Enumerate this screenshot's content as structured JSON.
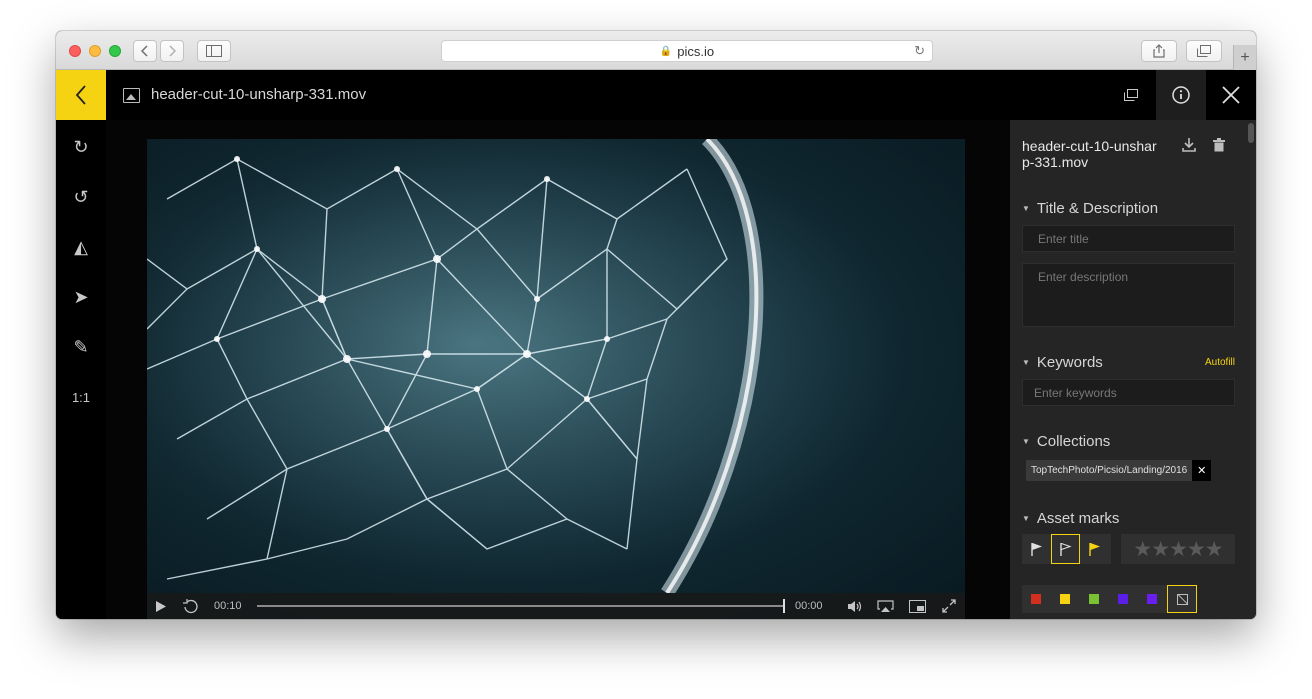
{
  "browser": {
    "url": "pics.io",
    "lock_glyph": "🔒",
    "reload_glyph": "↻",
    "new_tab_glyph": "+"
  },
  "header": {
    "file_name": "header-cut-10-unsharp-331.mov"
  },
  "tools": [
    {
      "name": "rotate-cw-icon",
      "glyph": "↻"
    },
    {
      "name": "rotate-ccw-icon",
      "glyph": "↺"
    },
    {
      "name": "flip-icon",
      "glyph": "◭"
    },
    {
      "name": "send-icon",
      "glyph": "➤"
    },
    {
      "name": "pencil-icon",
      "glyph": "✎"
    },
    {
      "name": "actual-size-icon",
      "glyph": "1:1"
    }
  ],
  "player": {
    "current_time": "00:10",
    "duration": "00:00",
    "progress": 1.0
  },
  "panel": {
    "title": "header-cut-10-unsharp-331.mov",
    "title_description": {
      "heading": "Title & Description",
      "title_placeholder": "Enter title",
      "description_placeholder": "Enter description"
    },
    "keywords": {
      "heading": "Keywords",
      "autofill": "Autofill",
      "placeholder": "Enter keywords"
    },
    "collections": {
      "heading": "Collections",
      "chip": "TopTechPhoto/Picsio/Landing/2016",
      "remove": "✕"
    },
    "asset_marks": {
      "heading": "Asset marks",
      "stars": "★★★★★",
      "rating": 0,
      "selected_flag": "unflagged"
    },
    "color_labels": [
      "#d32f1f",
      "#f5d312",
      "#7bc232",
      "#5a1ee6",
      "#6a1ef0"
    ]
  },
  "colors": {
    "accent": "#f5d312",
    "panel_bg": "#252525"
  }
}
